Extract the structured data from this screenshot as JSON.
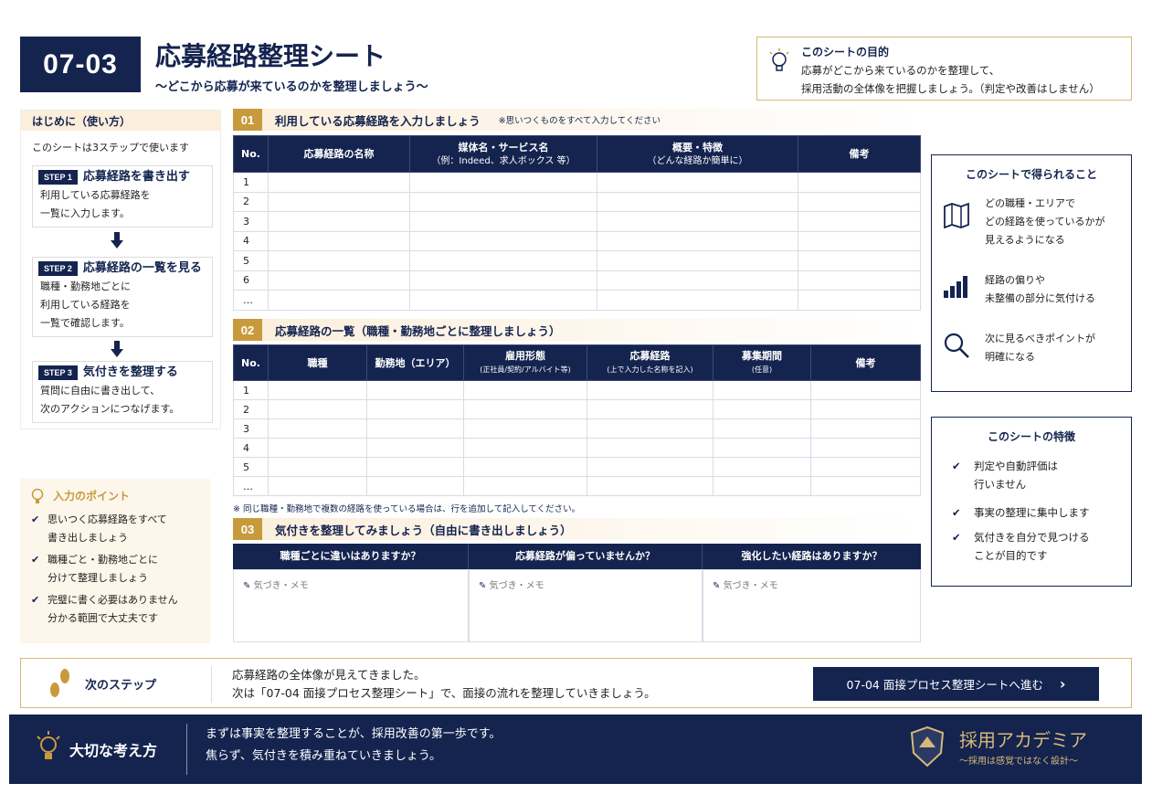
{
  "header": {
    "badge": "07-03",
    "title": "応募経路整理シート",
    "subtitle": "〜どこから応募が来ているのかを整理しましょう〜"
  },
  "purpose": {
    "heading": "このシートの目的",
    "line1": "応募がどこから来ているのかを整理して、",
    "line2": "採用活動の全体像を把握しましょう。（判定や改善はしません）"
  },
  "intro": {
    "heading": "はじめに（使い方）",
    "lead": "このシートは3ステップで使います",
    "steps": [
      {
        "tag": "STEP 1",
        "title": "応募経路を書き出す",
        "l1": "利用している応募経路を",
        "l2": "一覧に入力します。",
        "l3": ""
      },
      {
        "tag": "STEP 2",
        "title": "応募経路の一覧を見る",
        "l1": "職種・勤務地ごとに",
        "l2": "利用している経路を",
        "l3": "一覧で確認します。"
      },
      {
        "tag": "STEP 3",
        "title": "気付きを整理する",
        "l1": "質問に自由に書き出して、",
        "l2": "次のアクションにつなげます。",
        "l3": ""
      }
    ]
  },
  "points": {
    "heading": "入力のポイント",
    "items": [
      {
        "l1": "思いつく応募経路をすべて",
        "l2": "書き出しましょう"
      },
      {
        "l1": "職種ごと・勤務地ごとに",
        "l2": "分けて整理しましょう"
      },
      {
        "l1": "完璧に書く必要はありません",
        "l2": "分かる範囲で大丈夫です"
      }
    ]
  },
  "s1": {
    "num": "01",
    "title": "利用している応募経路を入力しましょう",
    "note": "※思いつくものをすべて入力してください",
    "cols": [
      "No.",
      "応募経路の名称",
      "媒体名・サービス名",
      "概要・特徴",
      "備考"
    ],
    "col_subs": [
      "",
      "",
      "（例：Indeed、求人ボックス 等）",
      "（どんな経路か簡単に）",
      ""
    ],
    "rows": [
      "1",
      "2",
      "3",
      "4",
      "5",
      "6",
      "…"
    ]
  },
  "s2": {
    "num": "02",
    "title": "応募経路の一覧（職種・勤務地ごとに整理しましょう）",
    "cols": [
      "No.",
      "職種",
      "勤務地（エリア）",
      "雇用形態",
      "応募経路",
      "募集期間",
      "備考"
    ],
    "col_subs": [
      "",
      "",
      "",
      "(正社員/契約/アルバイト等)",
      "(上で入力した名称を記入)",
      "(任意)",
      ""
    ],
    "rows": [
      "1",
      "2",
      "3",
      "4",
      "5",
      "…"
    ],
    "note": "※ 同じ職種・勤務地で複数の経路を使っている場合は、行を追加して記入してください。"
  },
  "s3": {
    "num": "03",
    "title": "気付きを整理してみましょう（自由に書き出しましょう）",
    "questions": [
      "職種ごとに違いはありますか？",
      "応募経路が偏っていませんか？",
      "強化したい経路はありますか？"
    ],
    "memo": "気づき・メモ"
  },
  "gains": {
    "heading": "このシートで得られること",
    "items": [
      {
        "icon": "map-icon",
        "l1": "どの職種・エリアで",
        "l2": "どの経路を使っているかが",
        "l3": "見えるようになる"
      },
      {
        "icon": "bar-chart-icon",
        "l1": "経路の偏りや",
        "l2": "未整備の部分に気付ける",
        "l3": ""
      },
      {
        "icon": "search-icon",
        "l1": "次に見るべきポイントが",
        "l2": "明確になる",
        "l3": ""
      }
    ]
  },
  "features": {
    "heading": "このシートの特徴",
    "items": [
      {
        "l1": "判定や自動評価は",
        "l2": "行いません"
      },
      {
        "l1": "事実の整理に集中します",
        "l2": ""
      },
      {
        "l1": "気付きを自分で見つける",
        "l2": "ことが目的です"
      }
    ]
  },
  "next": {
    "label": "次のステップ",
    "line1": "応募経路の全体像が見えてきました。",
    "line2": "次は「07-04 面接プロセス整理シート」で、面接の流れを整理していきましょう。",
    "button": "07-04 面接プロセス整理シートへ進む"
  },
  "footer": {
    "label": "大切な考え方",
    "line1": "まずは事実を整理することが、採用改善の第一歩です。",
    "line2": "焦らず、気付きを積み重ねていきましょう。",
    "brand": "採用アカデミア",
    "brand_sub": "〜採用は感覚ではなく設計〜"
  },
  "colors": {
    "navy": "#14244f",
    "gold": "#c89a3c"
  }
}
